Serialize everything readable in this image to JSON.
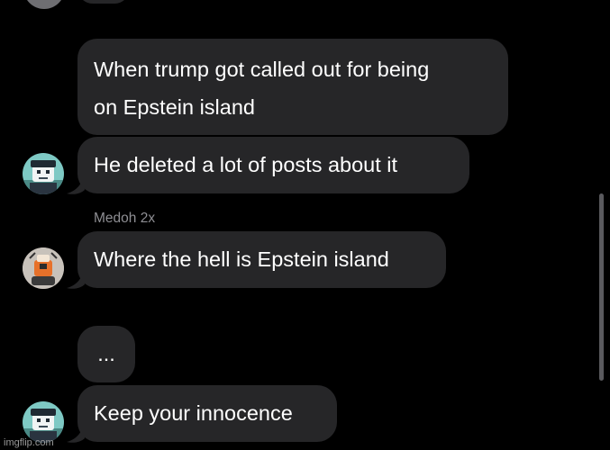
{
  "conversation": {
    "messages": [
      {
        "lines": [
          "When trump got called out for being",
          "on Epstein island"
        ]
      },
      {
        "lines": [
          "He deleted a lot of posts about it"
        ]
      },
      {
        "sender": "Medoh 2x",
        "lines": [
          "Where the hell is Epstein island"
        ]
      },
      {
        "lines": [
          "..."
        ]
      },
      {
        "lines": [
          "Keep your innocence"
        ]
      }
    ]
  },
  "watermark": "imgflip.com",
  "colors": {
    "background": "#000000",
    "bubble": "#262628",
    "sender_label": "#8e8e93"
  }
}
